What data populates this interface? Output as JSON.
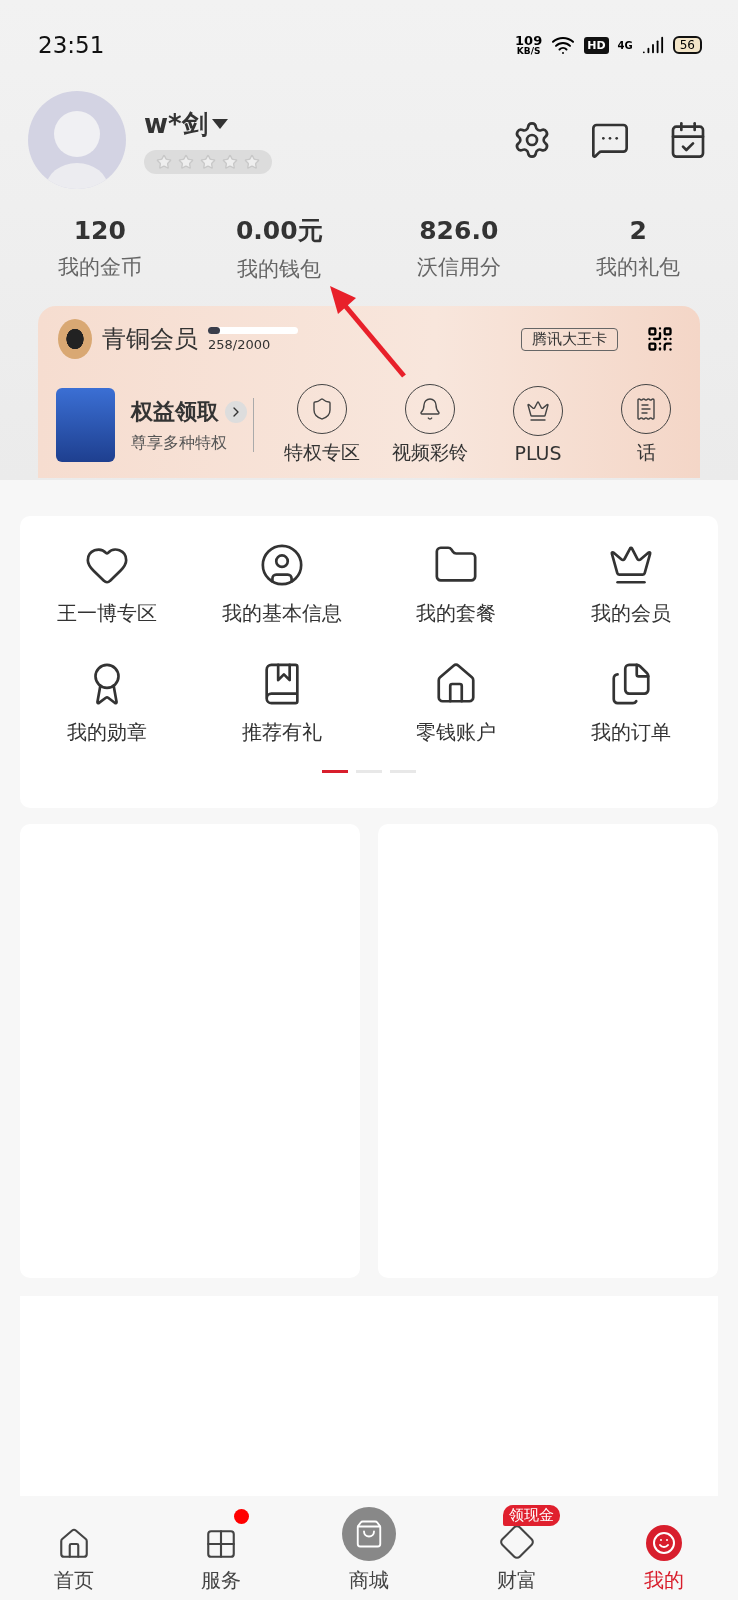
{
  "status_bar": {
    "time": "23:51",
    "speed": "109",
    "speed_unit": "KB/S",
    "hd": "HD",
    "network": "4G",
    "battery": "56"
  },
  "profile": {
    "name": "w*剑",
    "stars": 0
  },
  "stats": [
    {
      "value": "120",
      "label": "我的金币"
    },
    {
      "value": "0.00元",
      "label": "我的钱包"
    },
    {
      "value": "826.0",
      "label": "沃信用分"
    },
    {
      "value": "2",
      "label": "我的礼包"
    }
  ],
  "member_card": {
    "level_name": "青铜会员",
    "level": 0.129,
    "progress": "258/2000",
    "card_tag": "腾讯大王卡",
    "benefits": {
      "title": "权益领取",
      "subtitle": "尊享多种特权"
    },
    "privileges": [
      {
        "label": "特权专区",
        "kind": "flag"
      },
      {
        "label": "视频彩铃",
        "kind": "bell"
      },
      {
        "label": "PLUS",
        "kind": "crown"
      },
      {
        "label": "话",
        "kind": "bill"
      }
    ]
  },
  "menu": {
    "items": [
      {
        "label": "王一博专区",
        "kind": "heart"
      },
      {
        "label": "我的基本信息",
        "kind": "person"
      },
      {
        "label": "我的套餐",
        "kind": "folder"
      },
      {
        "label": "我的会员",
        "kind": "crown"
      },
      {
        "label": "我的勋章",
        "kind": "medal"
      },
      {
        "label": "推荐有礼",
        "kind": "book"
      },
      {
        "label": "零钱账户",
        "kind": "house"
      },
      {
        "label": "我的订单",
        "kind": "orders"
      }
    ],
    "pages": [
      {
        "selected": true
      },
      {
        "selected": false
      },
      {
        "selected": false
      }
    ]
  },
  "tab_bar": [
    {
      "label": "首页",
      "kind": "home",
      "selected": false,
      "dot": false
    },
    {
      "label": "服务",
      "kind": "grid",
      "selected": false,
      "dot": true
    },
    {
      "label": "商城",
      "kind": "bag",
      "selected": false,
      "dot": false
    },
    {
      "label": "财富",
      "kind": "diamond",
      "selected": false,
      "dot": false,
      "badge": "领现金"
    },
    {
      "label": "我的",
      "kind": "me",
      "selected": true,
      "dot": false
    }
  ]
}
